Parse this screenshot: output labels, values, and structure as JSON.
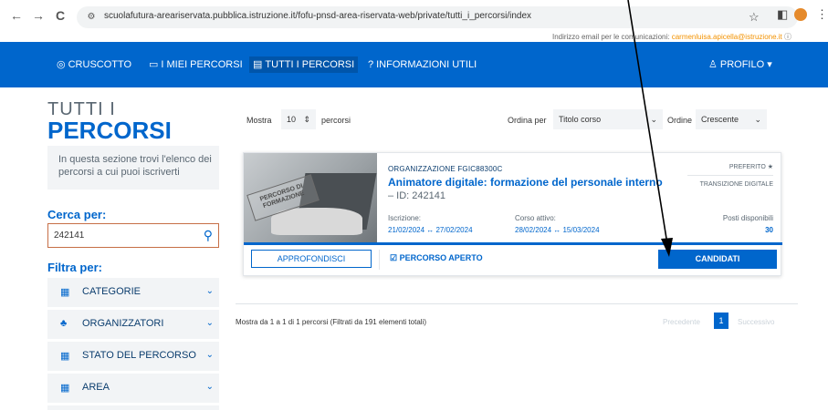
{
  "browser": {
    "back": "←",
    "forward": "→",
    "reload": "C",
    "url": "scuolafutura-areariservata.pubblica.istruzione.it/fofu-pnsd-area-riservata-web/private/tutti_i_percorsi/index",
    "star": "☆",
    "menu": "⋮",
    "ext": "◧"
  },
  "top_notice": {
    "label": "Indirizzo email per le comunicazioni:",
    "email": "carmenluisa.apicella@istruzione.it"
  },
  "nav": {
    "items": [
      {
        "icon": "◎",
        "label": "CRUSCOTTO"
      },
      {
        "icon": "▭",
        "label": "I MIEI PERCORSI"
      },
      {
        "icon": "▤",
        "label": "TUTTI I PERCORSI"
      },
      {
        "icon": "?",
        "label": "INFORMAZIONI UTILI"
      }
    ],
    "profile": {
      "icon": "♙",
      "label": "PROFILO",
      "caret": "▾"
    }
  },
  "sidebar": {
    "title_small": "TUTTI I",
    "title_big": "PERCORSI",
    "intro": "In questa sezione trovi l'elenco dei percorsi a cui puoi iscriverti",
    "search_label": "Cerca per:",
    "search_value": "242141",
    "search_icon": "⚲",
    "filter_label": "Filtra per:",
    "filters": [
      {
        "icon": "▦",
        "label": "CATEGORIE"
      },
      {
        "icon": "♣",
        "label": "ORGANIZZATORI"
      },
      {
        "icon": "▦",
        "label": "STATO DEL PERCORSO"
      },
      {
        "icon": "▦",
        "label": "AREA"
      }
    ],
    "chevron": "⌄"
  },
  "controls": {
    "show_label": "Mostra",
    "show_value": "10",
    "show_suffix": "percorsi",
    "order_by_label": "Ordina per",
    "order_by_value": "Titolo corso",
    "order_label": "Ordine",
    "order_value": "Crescente"
  },
  "card": {
    "image_text": "PERCORSO DI FORMAZIONE",
    "organization": "ORGANIZZAZIONE FGIC88300C",
    "title": "Animatore digitale: formazione del personale interno",
    "id": "– ID: 242141",
    "favorite": "PREFERITO ★",
    "area": "TRANSIZIONE DIGITALE",
    "iscrizione_label": "Iscrizione:",
    "iscrizione_value": "21/02/2024 ↔ 27/02/2024",
    "corso_label": "Corso attivo:",
    "corso_value": "28/02/2024 ↔ 15/03/2024",
    "posti_label": "Posti disponibili",
    "posti_value": "30",
    "approfondisci": "APPROFONDISCI",
    "status": "☑ PERCORSO APERTO",
    "candidati": "CANDIDATI"
  },
  "pagination": {
    "summary": "Mostra da 1 a 1 di 1 percorsi (Filtrati da 191 elementi totali)",
    "prev": "Precedente",
    "current": "1",
    "next": "Successivo"
  }
}
